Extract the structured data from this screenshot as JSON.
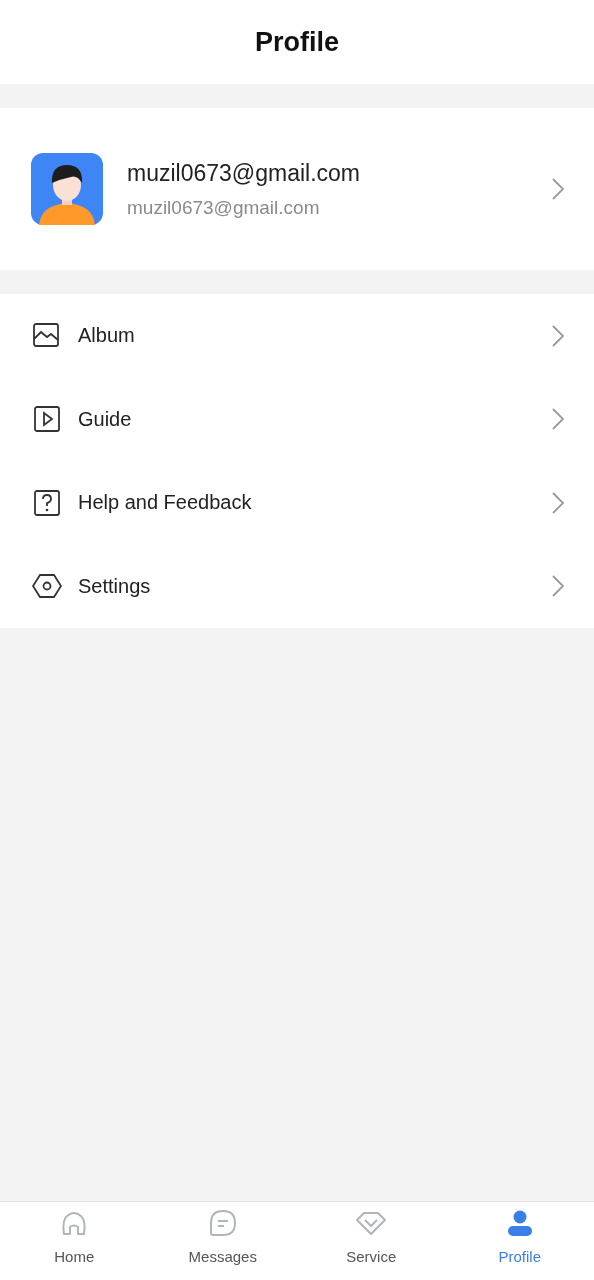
{
  "header": {
    "title": "Profile"
  },
  "account": {
    "name": "muzil0673@gmail.com",
    "email": "muzil0673@gmail.com"
  },
  "menu": [
    {
      "label": "Album"
    },
    {
      "label": "Guide"
    },
    {
      "label": "Help and Feedback"
    },
    {
      "label": "Settings"
    }
  ],
  "tabs": [
    {
      "label": "Home",
      "selected": false
    },
    {
      "label": "Messages",
      "selected": false
    },
    {
      "label": "Service",
      "selected": false
    },
    {
      "label": "Profile",
      "selected": true
    }
  ]
}
